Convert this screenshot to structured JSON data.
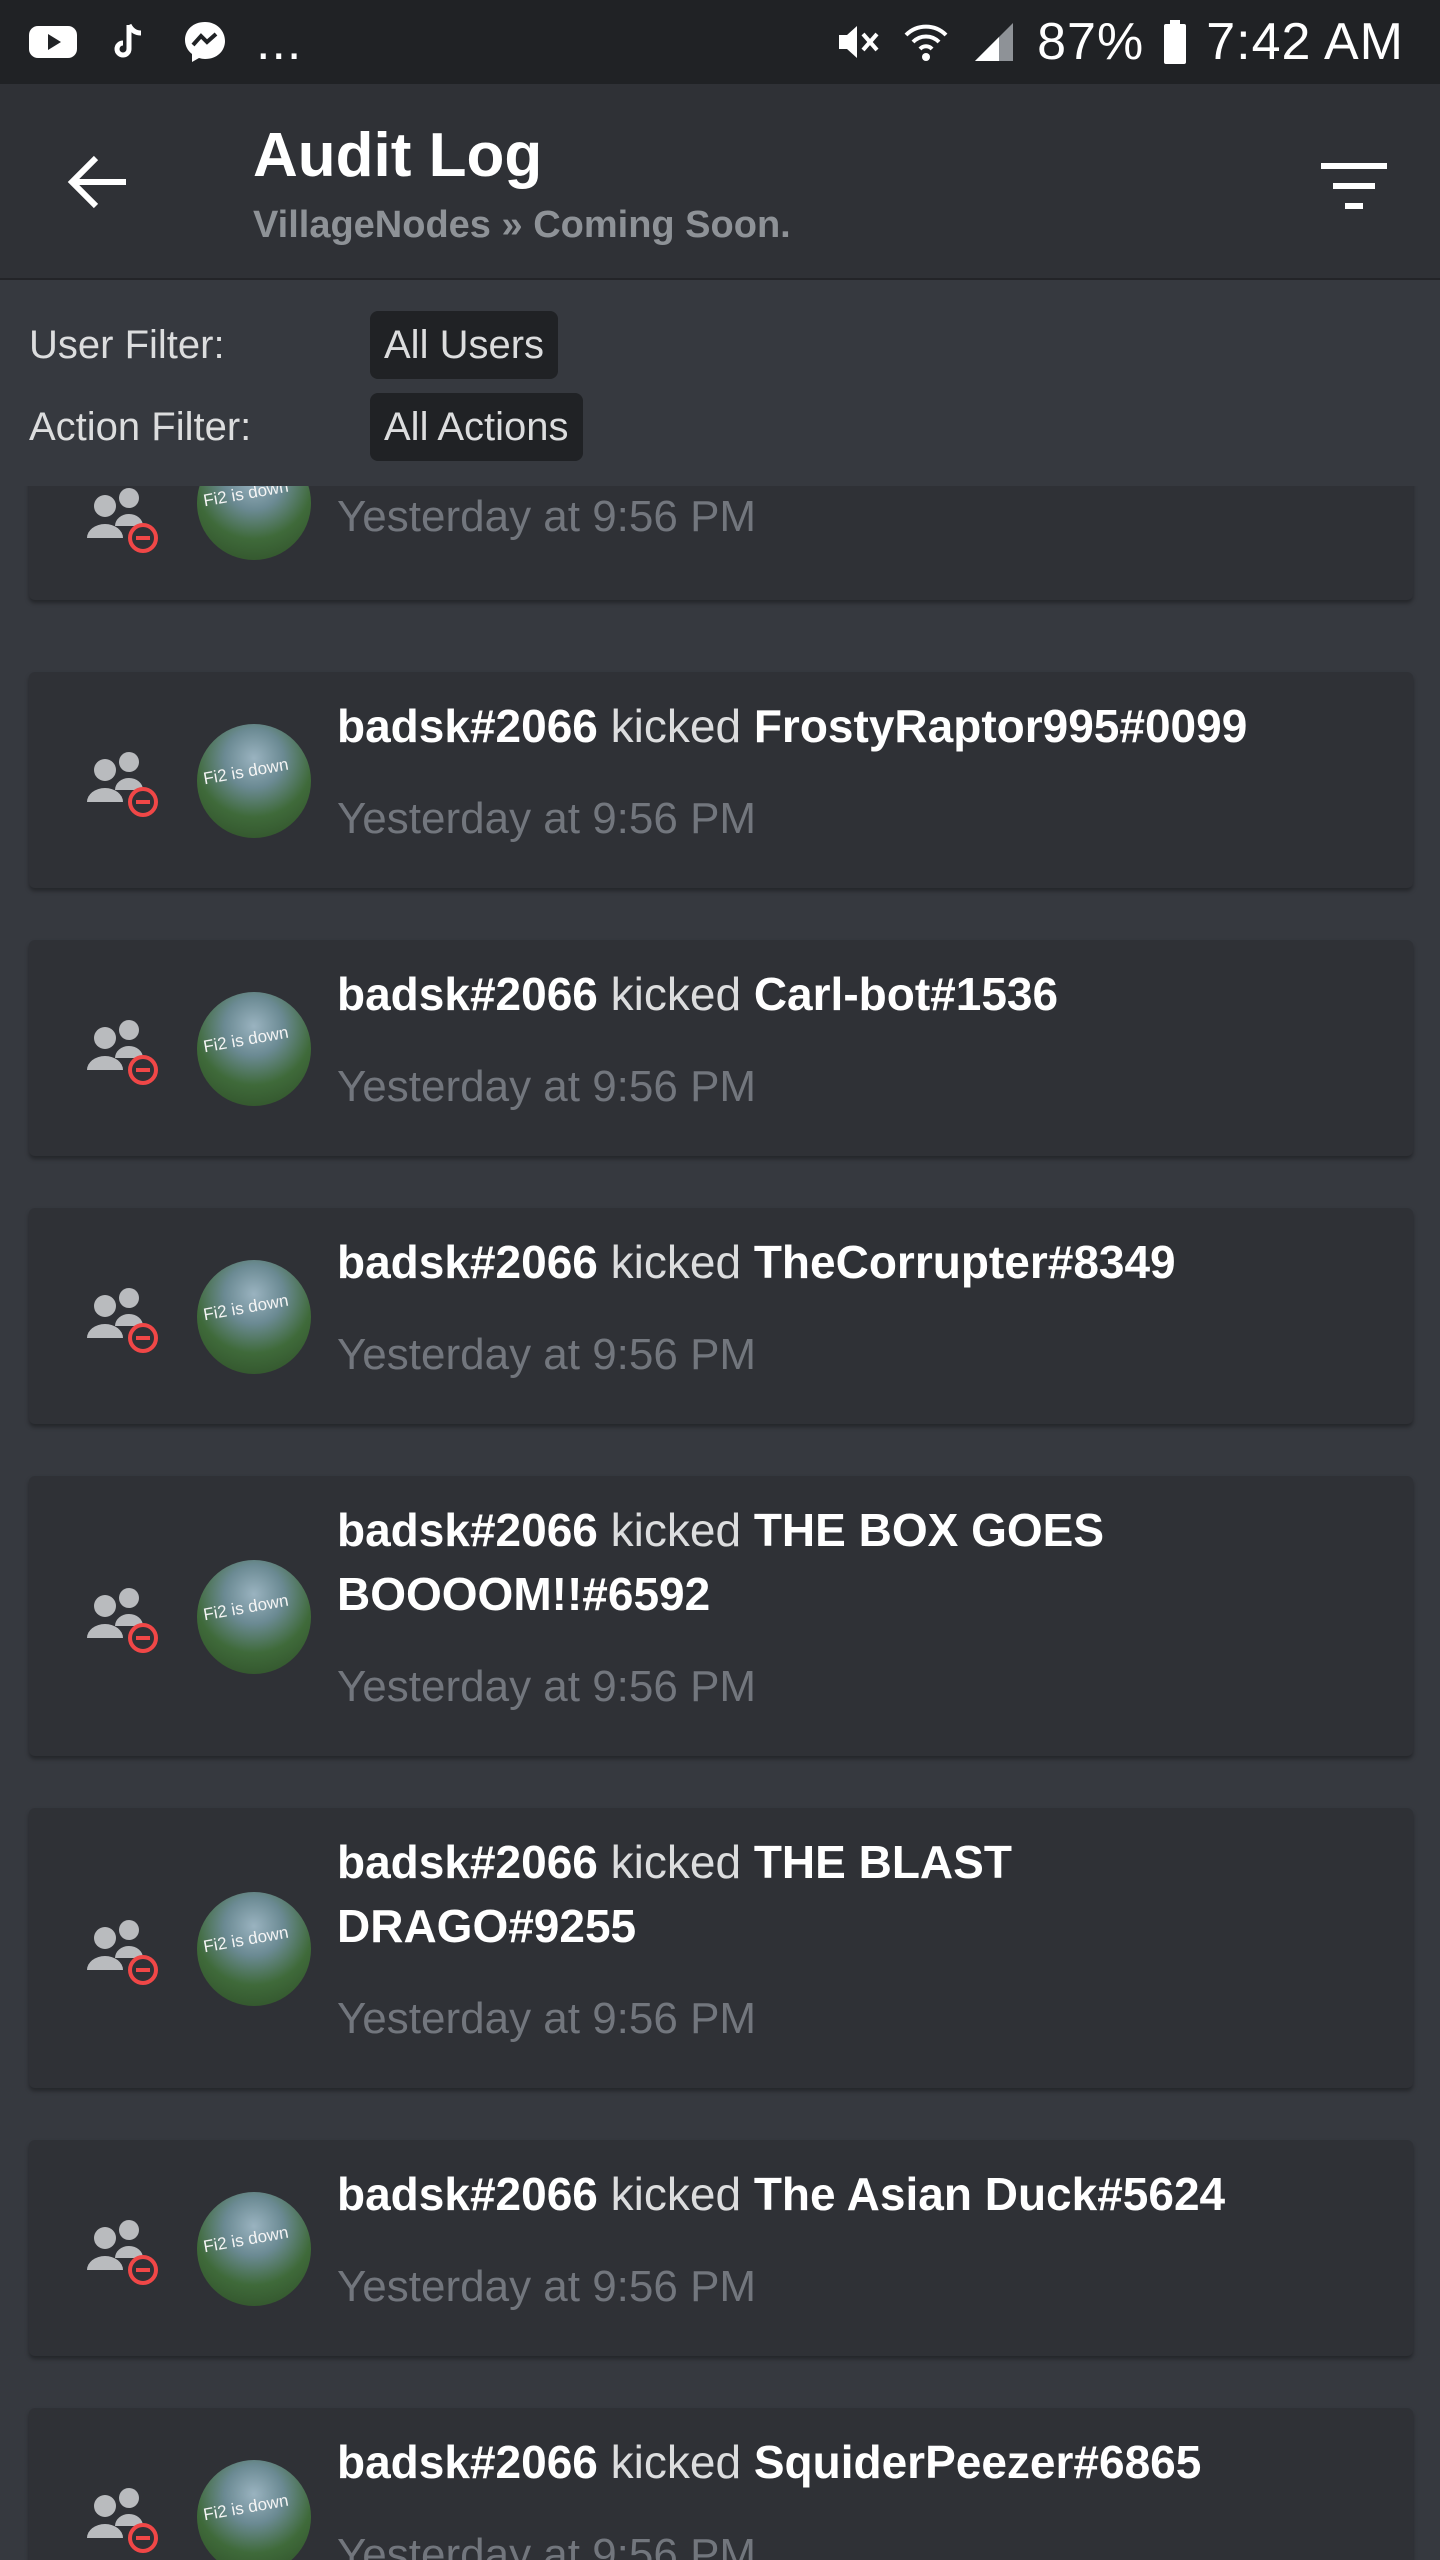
{
  "status_bar": {
    "battery": "87%",
    "time": "7:42 AM",
    "more": "..."
  },
  "header": {
    "title": "Audit Log",
    "subtitle": "VillageNodes » Coming Soon."
  },
  "filters": {
    "user_label": "User Filter:",
    "user_value": "All Users",
    "action_label": "Action Filter:",
    "action_value": "All Actions"
  },
  "entries": [
    {
      "actor": "",
      "action": "",
      "target": "",
      "time": "Yesterday at 9:56 PM",
      "avatar_text": "Fi2 is down"
    },
    {
      "actor": "badsk#2066",
      "action": "kicked",
      "target": "FrostyRaptor995#0099",
      "time": "Yesterday at 9:56 PM",
      "avatar_text": "Fi2 is down"
    },
    {
      "actor": "badsk#2066",
      "action": "kicked",
      "target": "Carl-bot#1536",
      "time": "Yesterday at 9:56 PM",
      "avatar_text": "Fi2 is down"
    },
    {
      "actor": "badsk#2066",
      "action": "kicked",
      "target": "TheCorrupter#8349",
      "time": "Yesterday at 9:56 PM",
      "avatar_text": "Fi2 is down"
    },
    {
      "actor": "badsk#2066",
      "action": "kicked",
      "target": "THE BOX GOES BOOOOM!!#6592",
      "time": "Yesterday at 9:56 PM",
      "avatar_text": "Fi2 is down"
    },
    {
      "actor": "badsk#2066",
      "action": "kicked",
      "target": "THE BLAST DRAGO#9255",
      "time": "Yesterday at 9:56 PM",
      "avatar_text": "Fi2 is down"
    },
    {
      "actor": "badsk#2066",
      "action": "kicked",
      "target": "The Asian Duck#5624",
      "time": "Yesterday at 9:56 PM",
      "avatar_text": "Fi2 is down"
    },
    {
      "actor": "badsk#2066",
      "action": "kicked",
      "target": "SquiderPeezer#6865",
      "time": "Yesterday at 9:56 PM",
      "avatar_text": "Fi2 is down"
    }
  ],
  "icons": {
    "back": "arrow-left-icon",
    "filter": "filter-icon",
    "entry_type": "member-kick-icon"
  },
  "colors": {
    "background": "#36393f",
    "card": "#2f3136",
    "header": "#2f3136",
    "statusbar": "#202225",
    "kick_red": "#f04747",
    "timestamp": "#72767d"
  }
}
